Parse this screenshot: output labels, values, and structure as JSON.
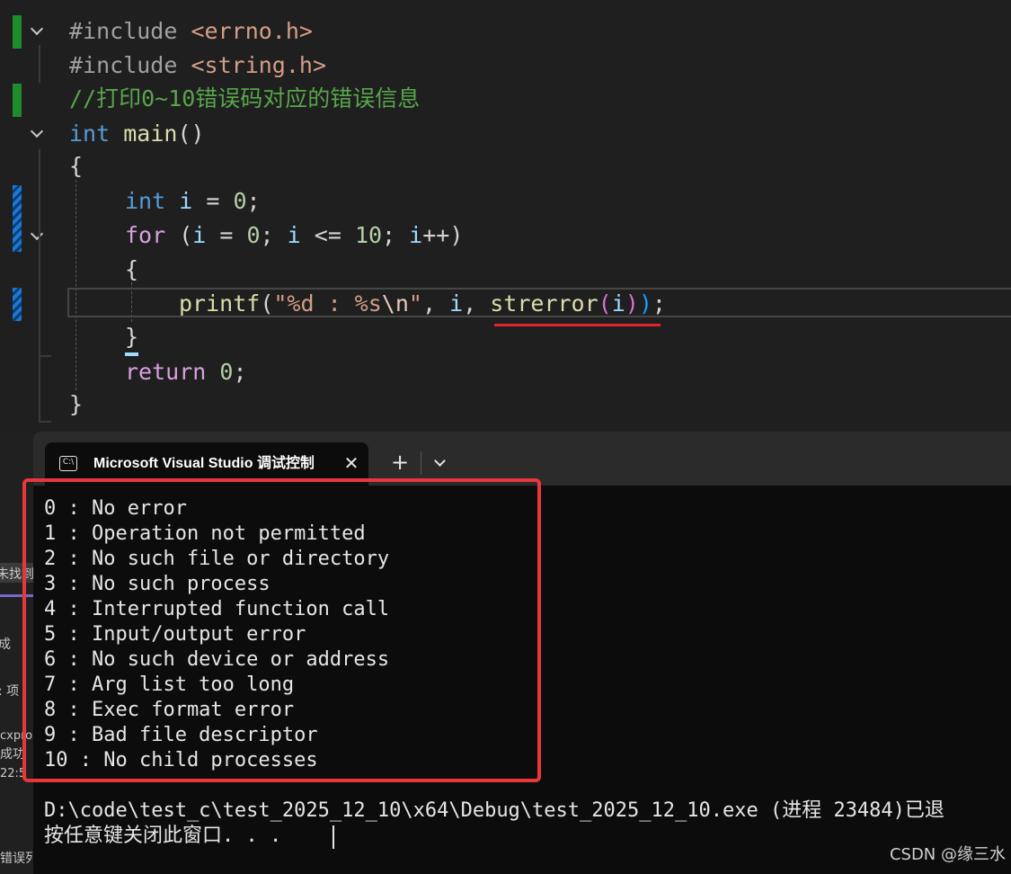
{
  "editor": {
    "lines": {
      "l1": {
        "directive": "#include",
        "header": "<errno.h>"
      },
      "l2": {
        "directive": "#include",
        "header": "<string.h>"
      },
      "l3": {
        "comment": "//打印0~10错误码对应的错误信息"
      },
      "l4": {
        "type": "int",
        "name": "main",
        "parens": "()"
      },
      "l5": {
        "brace": "{"
      },
      "l6": {
        "type": "int",
        "var": "i",
        "op": " = ",
        "num": "0",
        "end": ";"
      },
      "l7": {
        "kw": "for",
        "p1": " (",
        "v1": "i",
        "op1": " = ",
        "n1": "0",
        "s1": "; ",
        "v2": "i",
        "op2": " <= ",
        "n2": "10",
        "s2": "; ",
        "v3": "i",
        "inc": "++",
        "p2": ")"
      },
      "l8": {
        "brace": "{"
      },
      "l9": {
        "fn": "printf",
        "p1": "(",
        "str1": "\"%d : %s",
        "esc": "\\n",
        "str2": "\"",
        "comma1": ", ",
        "arg1": "i",
        "comma2": ", ",
        "fn2": "strerror",
        "p2": "(",
        "arg2": "i",
        "p3": ")",
        "p4": ")",
        "end": ";"
      },
      "l10": {
        "brace": "}"
      },
      "l11": {
        "kw": "return",
        "sp": " ",
        "num": "0",
        "end": ";"
      },
      "l12": {
        "brace": "}"
      }
    }
  },
  "left_strip": {
    "t1": "未找到",
    "t2": "成",
    "t3": ": 项",
    "t4": "cxpro",
    "t5": "成功",
    "t6": "22:5",
    "t7": "错误列"
  },
  "terminal": {
    "tab_title": "Microsoft Visual Studio 调试控制台",
    "tab_icon_text": "C:\\",
    "close_glyph": "✕",
    "new_tab_glyph": "+",
    "output": [
      "0 : No error",
      "1 : Operation not permitted",
      "2 : No such file or directory",
      "3 : No such process",
      "4 : Interrupted function call",
      "5 : Input/output error",
      "6 : No such device or address",
      "7 : Arg list too long",
      "8 : Exec format error",
      "9 : Bad file descriptor",
      "10 : No child processes"
    ],
    "exit_message": "D:\\code\\test_c\\test_2025_12_10\\x64\\Debug\\test_2025_12_10.exe (进程 23484)已退",
    "press_key_message": "按任意键关闭此窗口. . ."
  },
  "watermark": "CSDN @缘三水"
}
